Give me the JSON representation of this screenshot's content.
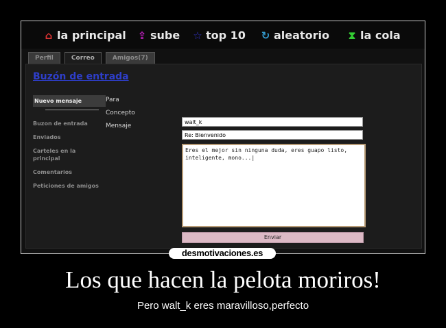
{
  "colors": {
    "background": "#000000",
    "panel": "#1c1c1c",
    "title": "#2e3ec9",
    "send_button": "#dcb9c5"
  },
  "topnav": {
    "items": [
      {
        "label": "la principal",
        "icon": "home-icon",
        "color": "#d33"
      },
      {
        "label": "sube",
        "icon": "upload-icon",
        "color": "#c2c"
      },
      {
        "label": "top 10",
        "icon": "star-icon",
        "color": "#33c"
      },
      {
        "label": "aleatorio",
        "icon": "refresh-icon",
        "color": "#39c"
      },
      {
        "label": "la cola",
        "icon": "hourglass-icon",
        "color": "#3c3"
      }
    ]
  },
  "tabs": [
    {
      "label": "Perfil",
      "active": false
    },
    {
      "label": "Correo",
      "active": true
    },
    {
      "label": "Amigos(7)",
      "active": false
    }
  ],
  "panel": {
    "title": "Buzón de entrada"
  },
  "sidebar": {
    "items": [
      {
        "label": "Nuevo mensaje",
        "active": true
      },
      {
        "label": "Buzon de entrada",
        "active": false
      },
      {
        "label": "Enviados",
        "active": false
      },
      {
        "label": "Carteles en la principal",
        "active": false
      },
      {
        "label": "Comentarios",
        "active": false
      },
      {
        "label": "Peticiones de amigos",
        "active": false
      }
    ]
  },
  "form": {
    "to_label": "Para",
    "to_value": "walt_k",
    "subject_label": "Concepto",
    "subject_value": "Re: Bienvenido",
    "message_label": "Mensaje",
    "message_value": "Eres el mejor sin ninguna duda, eres guapo listo, inteligente, mono...|",
    "send_label": "Enviar"
  },
  "poster": {
    "brand": "desmotivaciones.es",
    "headline": "Los que hacen la pelota moriros!",
    "subline": "Pero walt_k eres maravilloso,perfecto"
  }
}
